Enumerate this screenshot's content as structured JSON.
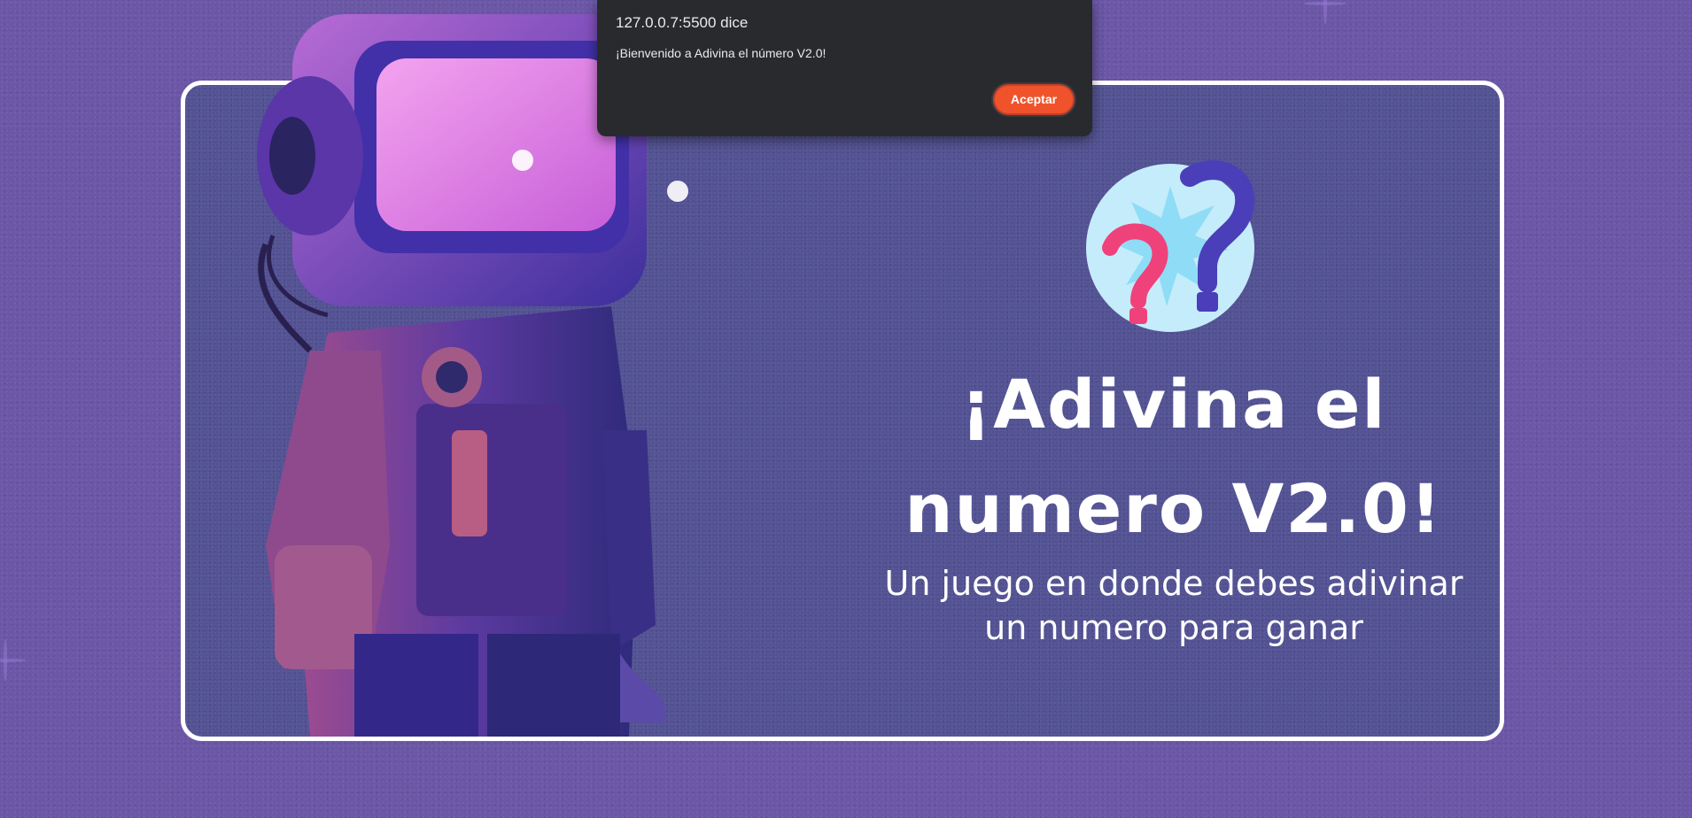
{
  "dialog": {
    "origin": "127.0.0.7:5500 dice",
    "message": "¡Bienvenido a Adivina el número V2.0!",
    "ok_label": "Aceptar",
    "accent_color": "#f0532b"
  },
  "hero": {
    "title_line1": "¡Adivina el",
    "title_line2": "numero V2.0!",
    "subtitle_line1": "Un juego en donde debes adivinar",
    "subtitle_line2": "un numero para ganar",
    "icon": "question-marks-icon",
    "illustration": "astronaut-illustration"
  },
  "colors": {
    "page_background": "#6b57a6",
    "card_background": "#535293",
    "card_border": "#ffffff",
    "dialog_background": "#292a2d"
  }
}
